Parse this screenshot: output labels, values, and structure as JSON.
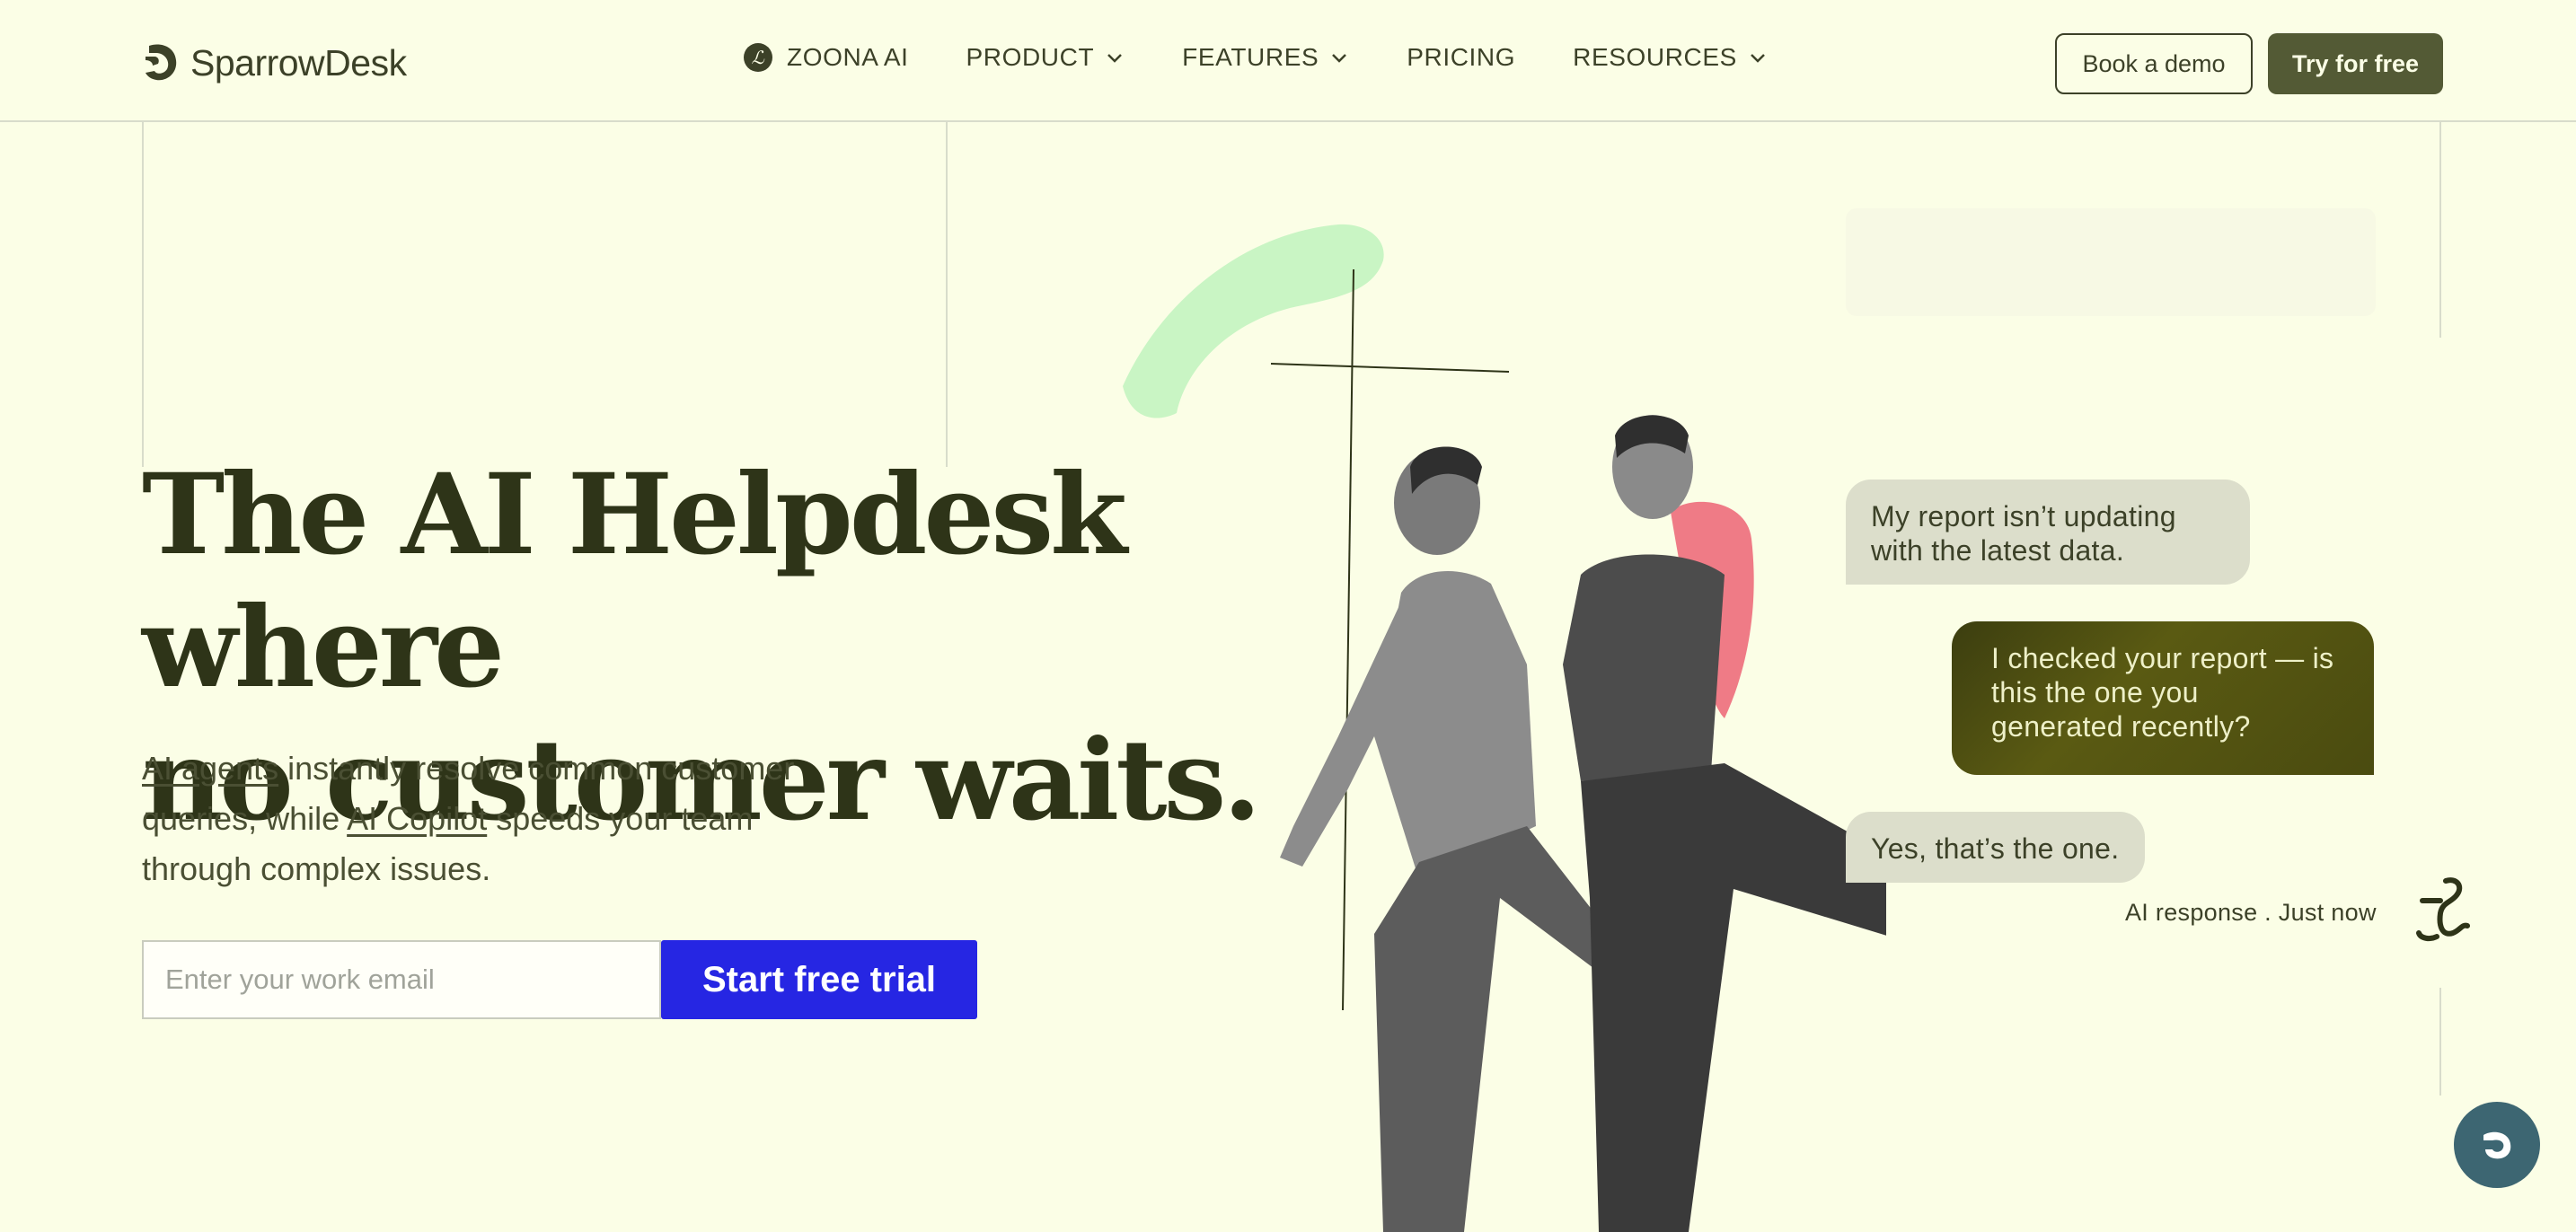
{
  "brand": {
    "name": "SparrowDesk"
  },
  "nav": {
    "items": [
      {
        "label": "ZOONA AI",
        "has_dropdown": false,
        "icon": "zoona-badge-icon"
      },
      {
        "label": "PRODUCT",
        "has_dropdown": true
      },
      {
        "label": "FEATURES",
        "has_dropdown": true
      },
      {
        "label": "PRICING",
        "has_dropdown": false
      },
      {
        "label": "RESOURCES",
        "has_dropdown": true
      }
    ],
    "book_demo_label": "Book a demo",
    "try_free_label": "Try for free"
  },
  "hero": {
    "headline_line1": "The AI Helpdesk where",
    "headline_line2": "no customer waits.",
    "sub_link1": "AI agents",
    "sub_text1": " instantly resolve common customer queries, while ",
    "sub_link2": "AI Copilot",
    "sub_text2": " speeds your team through complex issues.",
    "email_placeholder": "Enter your work email",
    "cta_label": "Start free trial"
  },
  "chat": {
    "messages": [
      {
        "from": "customer",
        "text": "My report isn’t updating with the latest data."
      },
      {
        "from": "agent",
        "text": "I checked your report — is this the one you generated recently?"
      },
      {
        "from": "customer",
        "text": "Yes, that’s the one."
      }
    ],
    "status": "AI response . Just now"
  },
  "colors": {
    "background": "#fbfee6",
    "primary_dark": "#535a35",
    "cta_blue": "#2626e3",
    "chat_fab": "#3d6672"
  }
}
